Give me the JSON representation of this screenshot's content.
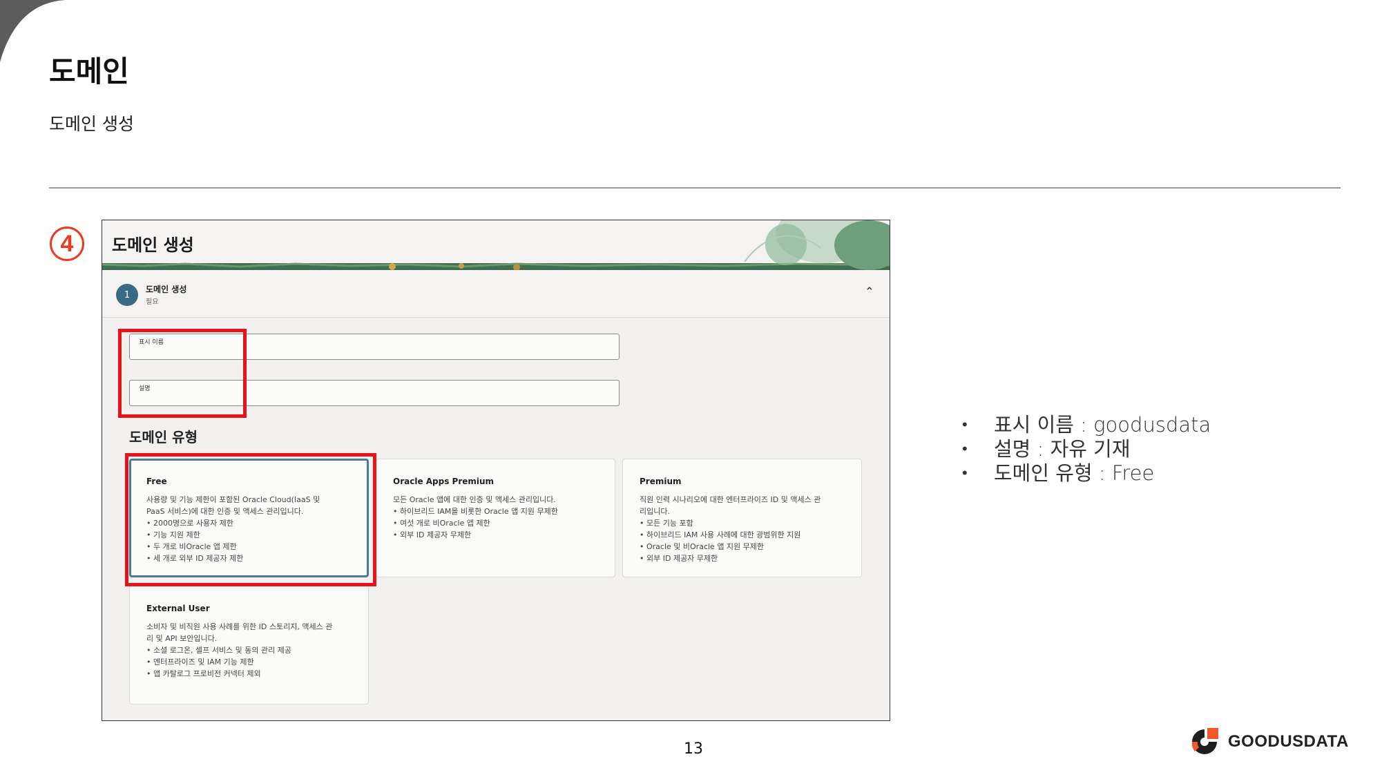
{
  "slide": {
    "title": "도메인",
    "subtitle": "도메인 생성",
    "step_number": "4",
    "page_number": "13",
    "bullets": [
      "표시 이름 : goodusdata",
      "설명 : 자유 기재",
      "도메인 유형 : Free"
    ],
    "logo_text": "GOODUSDATA"
  },
  "screenshot": {
    "header_title": "도메인 생성",
    "section": {
      "step": "1",
      "title": "도메인 생성",
      "subtitle": "필요"
    },
    "fields": {
      "display_name_label": "표시 이름",
      "display_name_value": "",
      "description_label": "설명",
      "description_value": ""
    },
    "domain_type_title": "도메인 유형",
    "cards": [
      {
        "title": "Free",
        "desc": "사용량 및 기능 제한이 포함된 Oracle Cloud(IaaS 및\nPaaS 서비스)에 대한 인증 및 액세스 관리입니다.",
        "items": [
          "2000명으로 사용자 제한",
          "기능 지원 제한",
          "두 개로 비Oracle 앱 제한",
          "세 개로 외부 ID 제공자 제한"
        ]
      },
      {
        "title": "Oracle Apps Premium",
        "desc": "모든 Oracle 앱에 대한 인증 및 액세스 관리입니다.",
        "items": [
          "하이브리드 IAM을 비롯한 Oracle 앱 지원 무제한",
          "여섯 개로 비Oracle 앱 제한",
          "외부 ID 제공자 무제한"
        ]
      },
      {
        "title": "Premium",
        "desc": "직원 인력 시나리오에 대한 엔터프라이즈 ID 및 액세스 관\n리입니다.",
        "items": [
          "모든 기능 포함",
          "하이브리드 IAM 사용 사례에 대한 광범위한 지원",
          "Oracle 및 비Oracle 앱 지원 무제한",
          "외부 ID 제공자 무제한"
        ]
      },
      {
        "title": "External User",
        "desc": "소비자 및 비직원 사용 사례를 위한 ID 스토리지, 액세스 관\n리 및 API 보안입니다.",
        "items": [
          "소셜 로그온, 셀프 서비스 및 동의 관리 제공",
          "엔터프라이즈 및 IAM 기능 제한",
          "앱 카탈로그 프로비전 커넥터 제외"
        ]
      }
    ]
  },
  "colors": {
    "highlight_red": "#e8121b",
    "step_marker": "#e83b1f",
    "step_circle": "#3a6b86",
    "selected_card_border": "#4a7a96",
    "logo_orange": "#f05a28",
    "corner_gray": "#5c5c5c"
  }
}
